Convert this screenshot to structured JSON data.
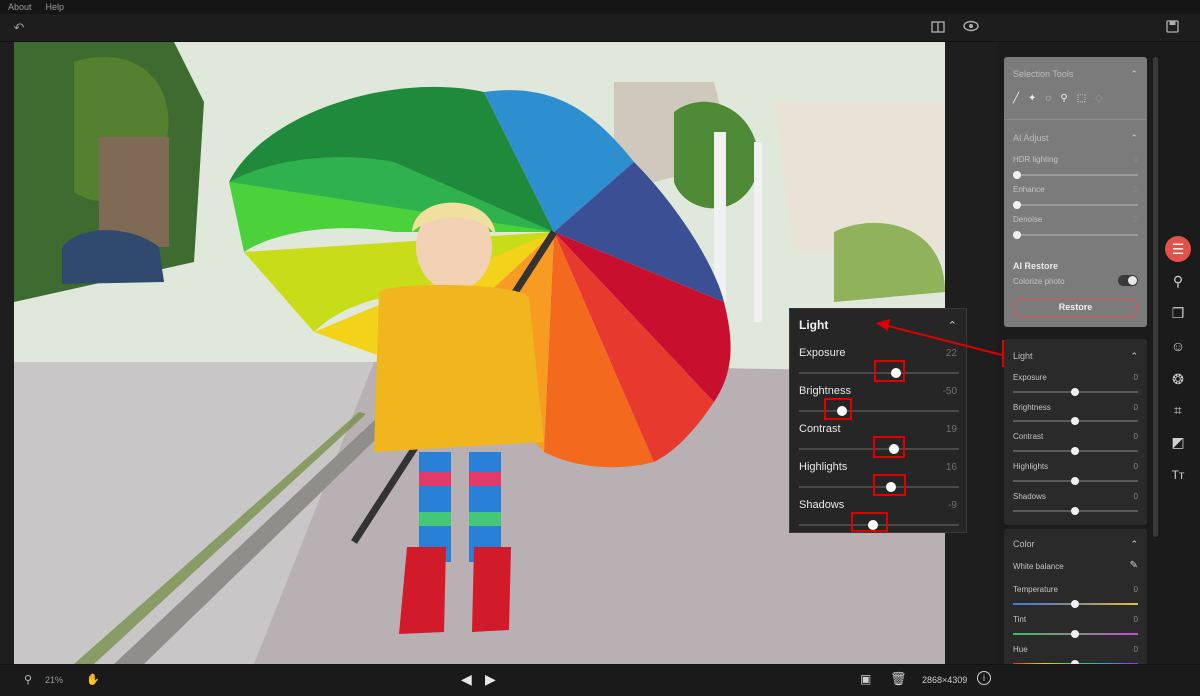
{
  "menu": {
    "about": "About",
    "help": "Help"
  },
  "colors": {
    "accent": "#e0524a",
    "annotation": "#e00000"
  },
  "right_panel": {
    "selection_tools": {
      "title": "Selection Tools",
      "tools": [
        "brush-tool-icon",
        "magic-wand-icon",
        "lasso-icon",
        "object-select-icon",
        "rect-select-icon",
        "eraser-icon"
      ]
    },
    "ai_adjust": {
      "title": "AI Adjust",
      "hdr": "HDR lighting",
      "hdr_value": "0",
      "enhance": "Enhance",
      "enhance_value": "0",
      "denoise": "Denoise",
      "denoise_value": "0"
    },
    "ai_restore": {
      "title": "AI Restore",
      "colorize": "Colorize photo",
      "restore_button": "Restore"
    },
    "light": {
      "title": "Light",
      "exposure": "Exposure",
      "exposure_value": "0",
      "brightness": "Brightness",
      "brightness_value": "0",
      "contrast": "Contrast",
      "contrast_value": "0",
      "highlights": "Highlights",
      "highlights_value": "0",
      "shadows": "Shadows",
      "shadows_value": "0"
    },
    "color": {
      "title": "Color",
      "white_balance": "White balance",
      "temperature": "Temperature",
      "temperature_value": "0",
      "tint": "Tint",
      "tint_value": "0",
      "hue": "Hue",
      "hue_value": "0"
    }
  },
  "light_popup": {
    "title": "Light",
    "rows": [
      {
        "label": "Exposure",
        "value": "22",
        "level": 0.61
      },
      {
        "label": "Brightness",
        "value": "-50",
        "level": 0.25
      },
      {
        "label": "Contrast",
        "value": "19",
        "level": 0.6
      },
      {
        "label": "Highlights",
        "value": "16",
        "level": 0.58
      },
      {
        "label": "Shadows",
        "value": "-9",
        "level": 0.46
      }
    ]
  },
  "status": {
    "zoom": "21%",
    "dimensions": "2868×4309"
  },
  "icons": {
    "undo": "undo-icon",
    "compare": "compare-icon",
    "preview": "eye-icon",
    "save": "save-icon",
    "zoom": "magnifier-icon",
    "pan": "hand-icon",
    "prev": "arrow-left-icon",
    "next": "arrow-right-icon",
    "photo": "image-icon",
    "delete": "trash-icon",
    "info": "info-icon"
  }
}
